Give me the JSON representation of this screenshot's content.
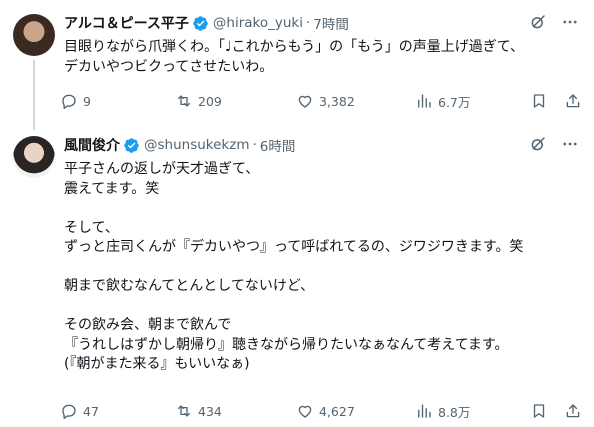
{
  "tweets": [
    {
      "display_name": "アルコ＆ピース平子",
      "handle": "@hirako_yuki",
      "separator": "·",
      "time": "7時間",
      "lines": [
        "目眼りながら爪弾くわ。「♩これからもう」の「もう」の声量上げ過ぎて、",
        "デカいやつビクってさせたいわ。"
      ],
      "replies": "9",
      "retweets": "209",
      "likes": "3,382",
      "views": "6.7万"
    },
    {
      "display_name": "風間俊介",
      "handle": "@shunsukekzm",
      "separator": "·",
      "time": "6時間",
      "lines": [
        "平子さんの返しが天才過ぎて、",
        "震えてます。笑",
        "",
        "そして、",
        "ずっと庄司くんが『デカいやつ』って呼ばれてるの、ジワジワきます。笑",
        "",
        "朝まで飲むなんてとんとしてないけど、",
        "",
        "その飲み会、朝まで飲んで",
        "『うれしはずかし朝帰り』聴きながら帰りたいなぁなんて考えてます。",
        "(『朝がまた来る』もいいなぁ)"
      ],
      "replies": "47",
      "retweets": "434",
      "likes": "4,627",
      "views": "8.8万"
    }
  ],
  "colors": {
    "text": "#0f1419",
    "secondary": "#536471",
    "verified": "#1d9bf0",
    "divider": "#eff3f4"
  },
  "icons": [
    "verified-badge-icon",
    "grok-icon",
    "more-icon",
    "reply-icon",
    "retweet-icon",
    "like-icon",
    "views-icon",
    "bookmark-icon",
    "share-icon"
  ]
}
